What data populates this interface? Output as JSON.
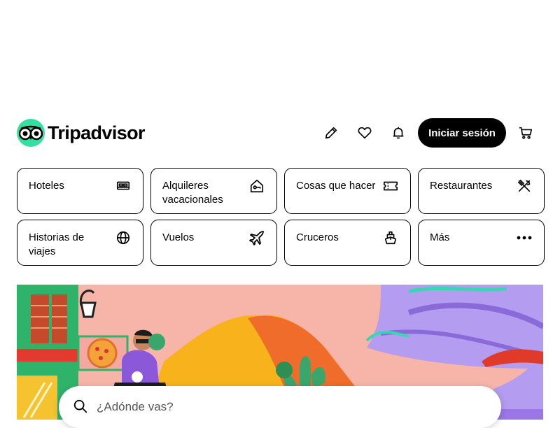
{
  "header": {
    "brand": "Tripadvisor",
    "signin_label": "Iniciar sesión",
    "icons": [
      "edit-pencil-icon",
      "heart-icon",
      "bell-icon",
      "cart-icon"
    ]
  },
  "categories": [
    {
      "label": "Hoteles",
      "icon": "bed-icon"
    },
    {
      "label": "Alquileres vacacionales",
      "icon": "house-key-icon"
    },
    {
      "label": "Cosas que hacer",
      "icon": "ticket-icon"
    },
    {
      "label": "Restaurantes",
      "icon": "utensils-icon"
    },
    {
      "label": "Historias de viajes",
      "icon": "globe-icon"
    },
    {
      "label": "Vuelos",
      "icon": "airplane-icon"
    },
    {
      "label": "Cruceros",
      "icon": "ship-icon"
    },
    {
      "label": "Más",
      "icon": "more-dots-icon"
    }
  ],
  "search": {
    "placeholder": "¿Adónde vas?"
  },
  "colors": {
    "brand_green": "#34e0a1",
    "hero_pink": "#f6b5a8",
    "black": "#000000"
  }
}
